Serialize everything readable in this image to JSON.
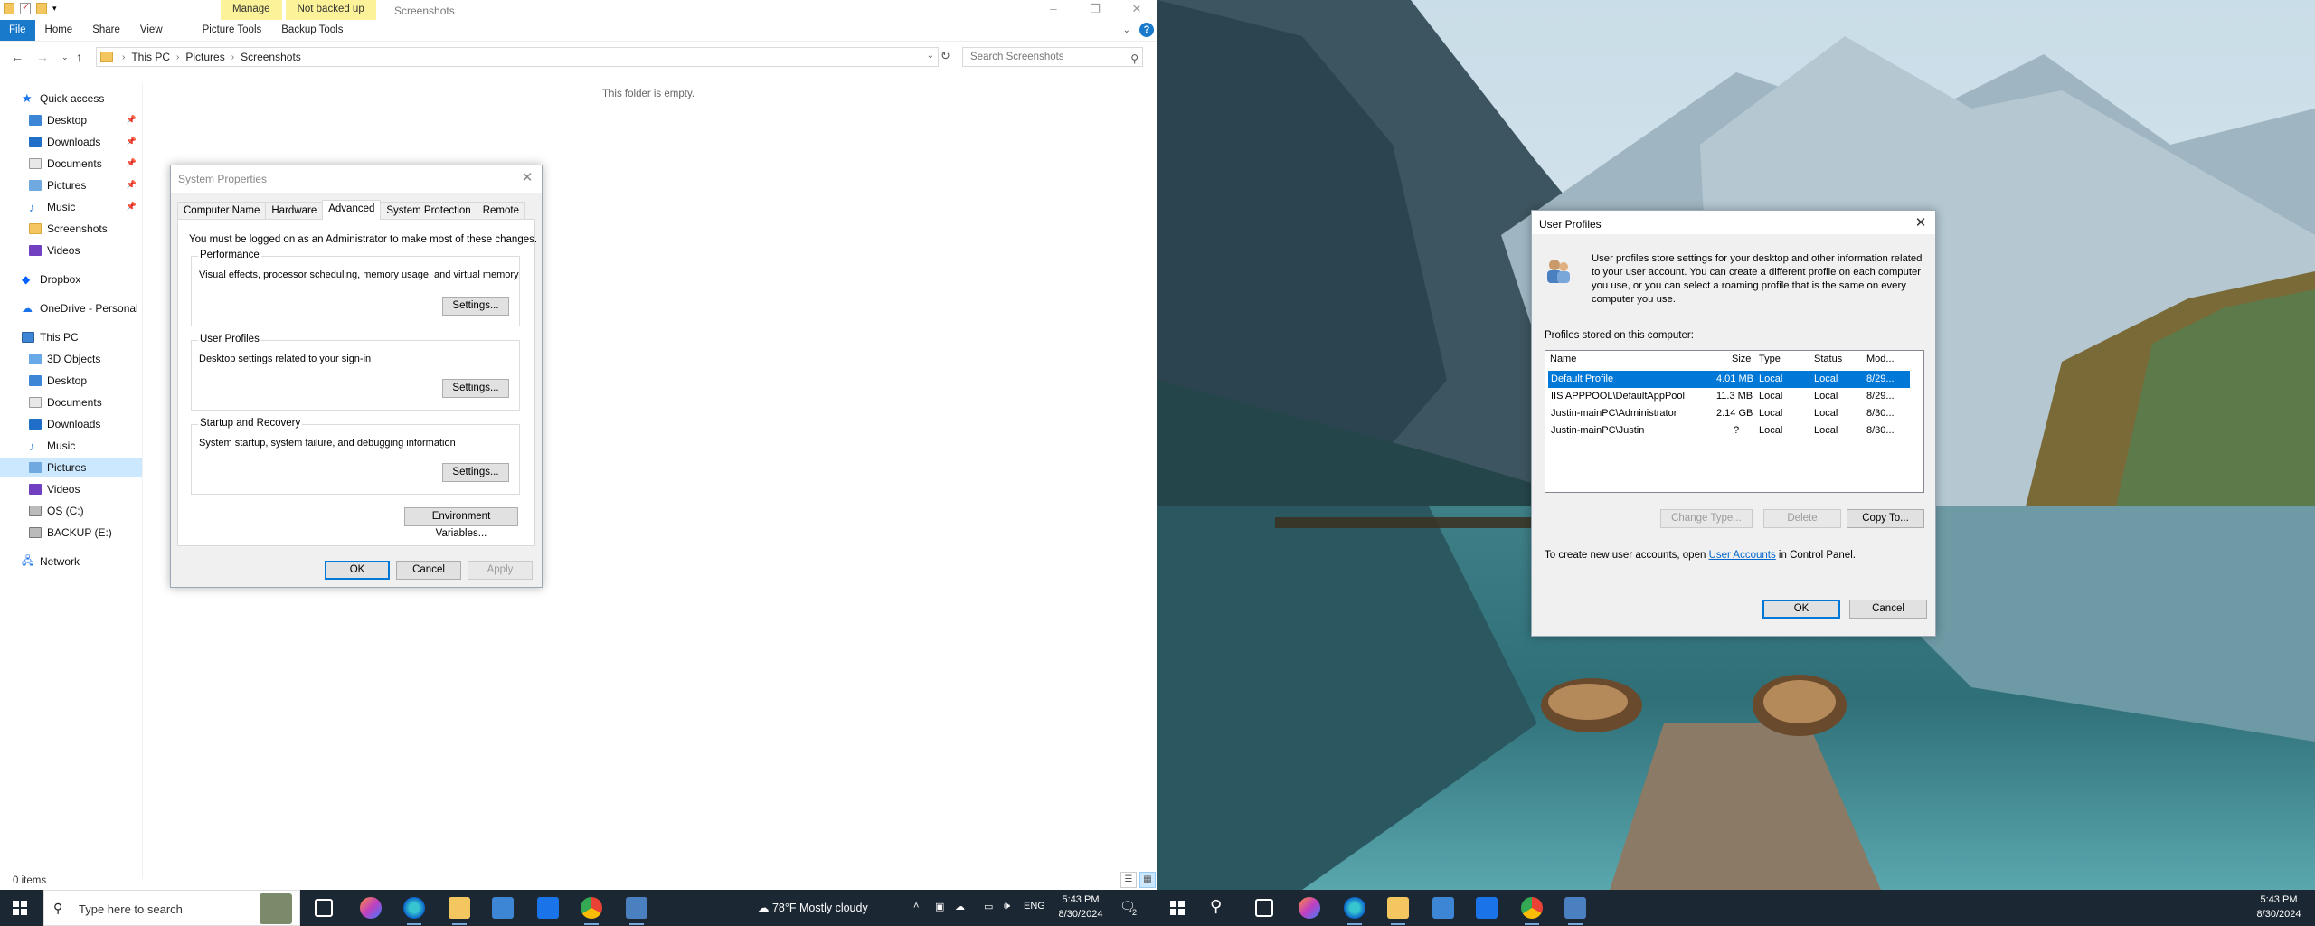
{
  "explorer": {
    "title": "Screenshots",
    "context_tabs": [
      "Manage",
      "Not backed up"
    ],
    "ribbon_tabs": [
      "File",
      "Home",
      "Share",
      "View",
      "Picture Tools",
      "Backup Tools"
    ],
    "breadcrumb": [
      "This PC",
      "Pictures",
      "Screenshots"
    ],
    "search_placeholder": "Search Screenshots",
    "empty_message": "This folder is empty.",
    "status": "0 items",
    "nav": {
      "quick_access": "Quick access",
      "qa_items": [
        "Desktop",
        "Downloads",
        "Documents",
        "Pictures",
        "Music",
        "Screenshots",
        "Videos"
      ],
      "dropbox": "Dropbox",
      "onedrive": "OneDrive - Personal",
      "this_pc": "This PC",
      "pc_items": [
        "3D Objects",
        "Desktop",
        "Documents",
        "Downloads",
        "Music",
        "Pictures",
        "Videos",
        "OS (C:)",
        "BACKUP (E:)"
      ],
      "network": "Network"
    }
  },
  "system_properties": {
    "title": "System Properties",
    "tabs": [
      "Computer Name",
      "Hardware",
      "Advanced",
      "System Protection",
      "Remote"
    ],
    "note": "You must be logged on as an Administrator to make most of these changes.",
    "performance": {
      "label": "Performance",
      "desc": "Visual effects, processor scheduling, memory usage, and virtual memory",
      "button": "Settings..."
    },
    "user_profiles": {
      "label": "User Profiles",
      "desc": "Desktop settings related to your sign-in",
      "button": "Settings..."
    },
    "startup": {
      "label": "Startup and Recovery",
      "desc": "System startup, system failure, and debugging information",
      "button": "Settings..."
    },
    "env_button": "Environment Variables...",
    "ok": "OK",
    "cancel": "Cancel",
    "apply": "Apply"
  },
  "user_profiles": {
    "title": "User Profiles",
    "description": "User profiles store settings for your desktop and other information related to your user account. You can create a different profile on each computer you use, or you can select a roaming profile that is the same on every computer you use.",
    "list_label": "Profiles stored on this computer:",
    "columns": [
      "Name",
      "Size",
      "Type",
      "Status",
      "Mod..."
    ],
    "rows": [
      {
        "name": "Default Profile",
        "size": "4.01 MB",
        "type": "Local",
        "status": "Local",
        "mod": "8/29..."
      },
      {
        "name": "IIS APPPOOL\\DefaultAppPool",
        "size": "11.3 MB",
        "type": "Local",
        "status": "Local",
        "mod": "8/29..."
      },
      {
        "name": "Justin-mainPC\\Administrator",
        "size": "2.14 GB",
        "type": "Local",
        "status": "Local",
        "mod": "8/30..."
      },
      {
        "name": "Justin-mainPC\\Justin",
        "size": "?",
        "type": "Local",
        "status": "Local",
        "mod": "8/30..."
      }
    ],
    "change_type": "Change Type...",
    "delete": "Delete",
    "copy_to": "Copy To...",
    "note_prefix": "To create new user accounts, open",
    "note_link": "User Accounts",
    "note_suffix": "in Control Panel.",
    "ok": "OK",
    "cancel": "Cancel"
  },
  "taskbar_left": {
    "search_placeholder": "Type here to search",
    "weather": "78°F  Mostly cloudy",
    "lang": "ENG",
    "time": "5:43 PM",
    "date": "8/30/2024",
    "notif_count": "2"
  },
  "taskbar_right": {
    "time": "5:43 PM",
    "date": "8/30/2024"
  },
  "colors": {
    "accent": "#0078d7",
    "taskbar": "#1b2733",
    "context_tab": "#fbf29a"
  }
}
